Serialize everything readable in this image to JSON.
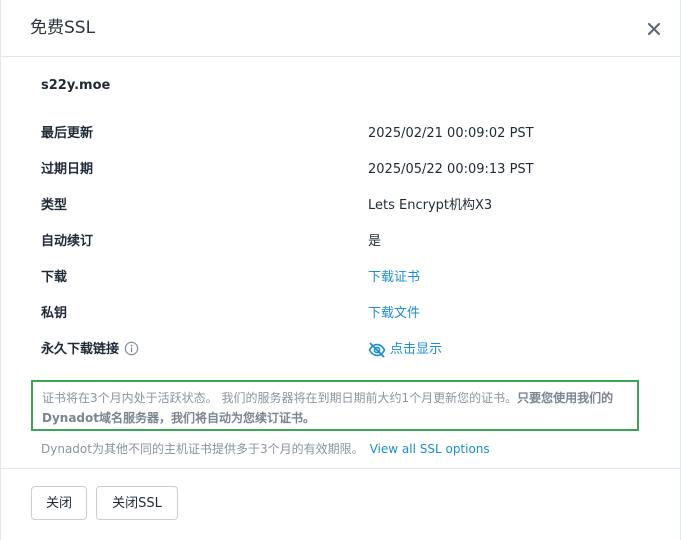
{
  "dialog": {
    "title": "免费SSL",
    "close_icon": "close-icon"
  },
  "domain": "s22y.moe",
  "details": {
    "last_updated": {
      "label": "最后更新",
      "value": "2025/02/21 00:09:02 PST"
    },
    "expiry_date": {
      "label": "过期日期",
      "value": "2025/05/22 00:09:13 PST"
    },
    "type": {
      "label": "类型",
      "value": "Lets Encrypt机构X3"
    },
    "auto_renew": {
      "label": "自动续订",
      "value": "是"
    },
    "download": {
      "label": "下载",
      "value": "下载证书"
    },
    "private_key": {
      "label": "私钥",
      "value": "下载文件"
    },
    "permanent_link": {
      "label": "永久下载链接",
      "value": "点击显示",
      "info_icon": "info-icon",
      "reveal_icon": "eye-slash-icon"
    }
  },
  "notice": {
    "text_normal": "证书将在3个月内处于活跃状态。 我们的服务器将在到期日期前大约1个月更新您的证书。",
    "text_bold": "只要您使用我们的Dynadot域名服务器，我们将自动为您续订证书。"
  },
  "note": {
    "text": "Dynadot为其他不同的主机证书提供多于3个月的有效期限。",
    "link": "View all SSL options"
  },
  "footer": {
    "close_button": "关闭",
    "close_ssl_button": "关闭SSL"
  },
  "colors": {
    "link": "#1a8fd1",
    "notice_border": "#3aa655",
    "muted_text": "#8a94a0"
  }
}
